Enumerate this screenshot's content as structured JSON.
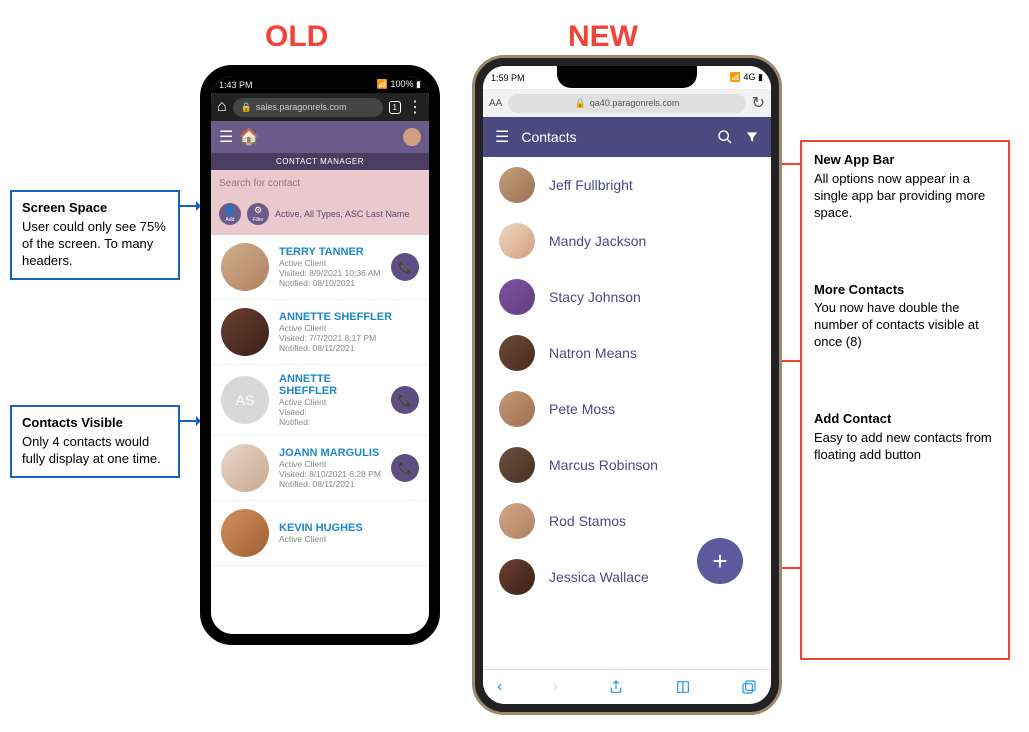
{
  "headings": {
    "old": "OLD",
    "new": "NEW"
  },
  "left_annotations": {
    "screen_space": {
      "title": "Screen Space",
      "body": "User could only see 75% of the screen. To many headers."
    },
    "contacts_visible": {
      "title": "Contacts Visible",
      "body": "Only 4 contacts would fully display at one time."
    }
  },
  "right_annotations": {
    "app_bar": {
      "title": "New App Bar",
      "body": "All options now appear in a single app bar providing more space."
    },
    "more_contacts": {
      "title": "More Contacts",
      "body": "You now have double the number of contacts visible at once (8)"
    },
    "add_contact": {
      "title": "Add Contact",
      "body": "Easy to add new contacts from floating add button"
    }
  },
  "old_phone": {
    "time": "1:43 PM",
    "battery": "100%",
    "url": "sales.paragonrels.com",
    "tab_count": "1",
    "screen_title": "CONTACT MANAGER",
    "search_placeholder": "Search for contact",
    "add_label": "Add",
    "filter_label": "Filter",
    "filter_text": "Active, All Types, ASC Last Name",
    "contacts": [
      {
        "name": "TERRY TANNER",
        "status": "Active Client",
        "visited": "Visited: 8/9/2021 10:36 AM",
        "notified": "Notified: 08/10/2021",
        "initials": "",
        "call": true
      },
      {
        "name": "ANNETTE SHEFFLER",
        "status": "Active Client",
        "visited": "Visited: 7/7/2021 8:17 PM",
        "notified": "Notified: 08/11/2021",
        "initials": "",
        "call": false
      },
      {
        "name": "ANNETTE SHEFFLER",
        "status": "Active Client",
        "visited": "Visited:",
        "notified": "Notified:",
        "initials": "AS",
        "call": true
      },
      {
        "name": "JOANN MARGULIS",
        "status": "Active Client",
        "visited": "Visited: 8/10/2021 6:28 PM",
        "notified": "Notified: 08/11/2021",
        "initials": "",
        "call": true
      },
      {
        "name": "KEVIN HUGHES",
        "status": "Active Client",
        "visited": "",
        "notified": "",
        "initials": "",
        "call": false
      }
    ]
  },
  "new_phone": {
    "time": "1:59 PM",
    "signal": "4G",
    "aa": "AA",
    "url": "qa40.paragonrels.com",
    "appbar_title": "Contacts",
    "contacts": [
      {
        "name": "Jeff Fullbright"
      },
      {
        "name": "Mandy Jackson"
      },
      {
        "name": "Stacy Johnson"
      },
      {
        "name": "Natron Means"
      },
      {
        "name": "Pete Moss"
      },
      {
        "name": "Marcus Robinson"
      },
      {
        "name": "Rod Stamos"
      },
      {
        "name": "Jessica Wallace"
      }
    ]
  }
}
